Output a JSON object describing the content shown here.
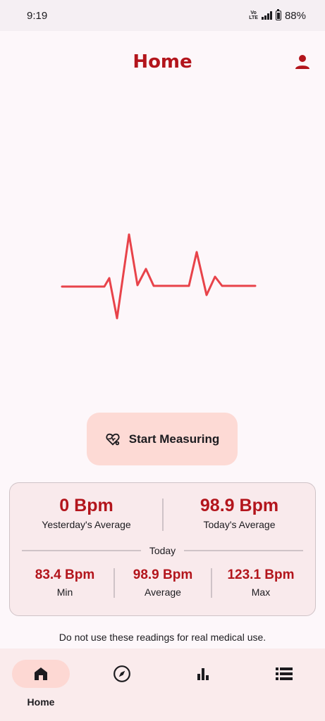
{
  "status_bar": {
    "time": "9:19",
    "network": "Vo LTE",
    "battery": "88%"
  },
  "app_bar": {
    "title": "Home",
    "profile_icon": "person-icon"
  },
  "measure_button": {
    "label": "Start Measuring",
    "icon": "heart-gear-icon"
  },
  "stats": {
    "yesterday": {
      "value": "0 Bpm",
      "label": "Yesterday's Average"
    },
    "today": {
      "value": "98.9 Bpm",
      "label": "Today's Average"
    },
    "section_label": "Today",
    "min": {
      "value": "83.4 Bpm",
      "label": "Min"
    },
    "average": {
      "value": "98.9 Bpm",
      "label": "Average"
    },
    "max": {
      "value": "123.1 Bpm",
      "label": "Max"
    }
  },
  "disclaimer": "Do not use these readings for real medical use.",
  "nav": {
    "items": [
      {
        "label": "Home",
        "icon": "home-icon",
        "active": true
      },
      {
        "label": "",
        "icon": "compass-icon",
        "active": false
      },
      {
        "label": "",
        "icon": "bar-chart-icon",
        "active": false
      },
      {
        "label": "",
        "icon": "list-icon",
        "active": false
      }
    ]
  },
  "colors": {
    "accent": "#b3151c",
    "ecg_line": "#e8434a",
    "button_bg": "#fddad5",
    "card_bg": "#f9eaec",
    "nav_bg": "#faebec"
  }
}
